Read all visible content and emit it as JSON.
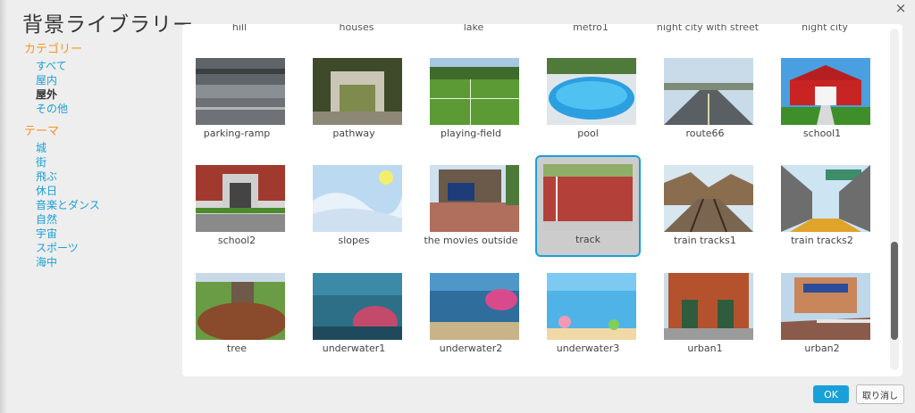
{
  "dialog": {
    "title": "背景ライブラリー",
    "close_glyph": "×",
    "ok_label": "OK",
    "cancel_label": "取り消し"
  },
  "sidebar": {
    "category_title": "カテゴリー",
    "categories": [
      "すべて",
      "屋内",
      "屋外",
      "その他"
    ],
    "selected_category": "屋外",
    "theme_title": "テーマ",
    "themes": [
      "城",
      "街",
      "飛ぶ",
      "休日",
      "音楽とダンス",
      "自然",
      "宇宙",
      "スポーツ",
      "海中"
    ]
  },
  "top_row_labels": [
    "hill",
    "houses",
    "lake",
    "metro1",
    "night city with street",
    "night city"
  ],
  "rows": [
    [
      "parking-ramp",
      "pathway",
      "playing-field",
      "pool",
      "route66",
      "school1"
    ],
    [
      "school2",
      "slopes",
      "the movies outside",
      "track",
      "train tracks1",
      "train tracks2"
    ],
    [
      "tree",
      "underwater1",
      "underwater2",
      "underwater3",
      "urban1",
      "urban2"
    ]
  ],
  "selected_item": "track",
  "colors": {
    "accent": "#1aa0d8",
    "category_heading": "#f7941d"
  }
}
